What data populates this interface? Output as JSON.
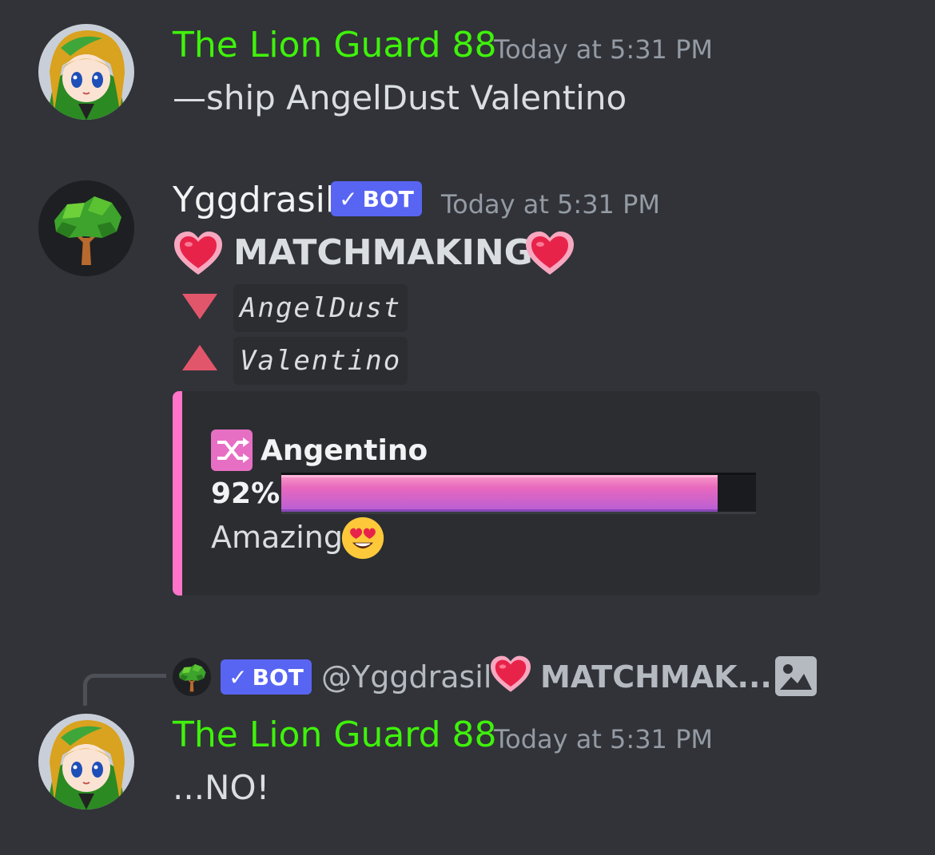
{
  "theme": {
    "background": "#313338",
    "username_green": "#3ff20b",
    "bot_badge": "#5865f2",
    "embed_accent": "#ff73c8"
  },
  "messages": [
    {
      "author": "The Lion Guard 88",
      "timestamp": "Today at 5:31 PM",
      "text": "—ship AngelDust Valentino",
      "avatar_icon": "anime-character-avatar"
    },
    {
      "author": "Yggdrasil",
      "bot_badge": "BOT",
      "timestamp": "Today at 5:31 PM",
      "avatar_icon": "tree-avatar",
      "heading": "MATCHMAKING",
      "names": [
        "AngelDust",
        "Valentino"
      ],
      "embed": {
        "title": "Angentino",
        "percent": "92%",
        "percent_value": 0.92,
        "rating": "Amazing"
      }
    },
    {
      "reply": {
        "bot_badge": "BOT",
        "mention": "@Yggdrasil",
        "preview": "MATCHMAK..."
      },
      "author": "The Lion Guard 88",
      "timestamp": "Today at 5:31 PM",
      "text": "...NO!",
      "avatar_icon": "anime-character-avatar"
    }
  ]
}
